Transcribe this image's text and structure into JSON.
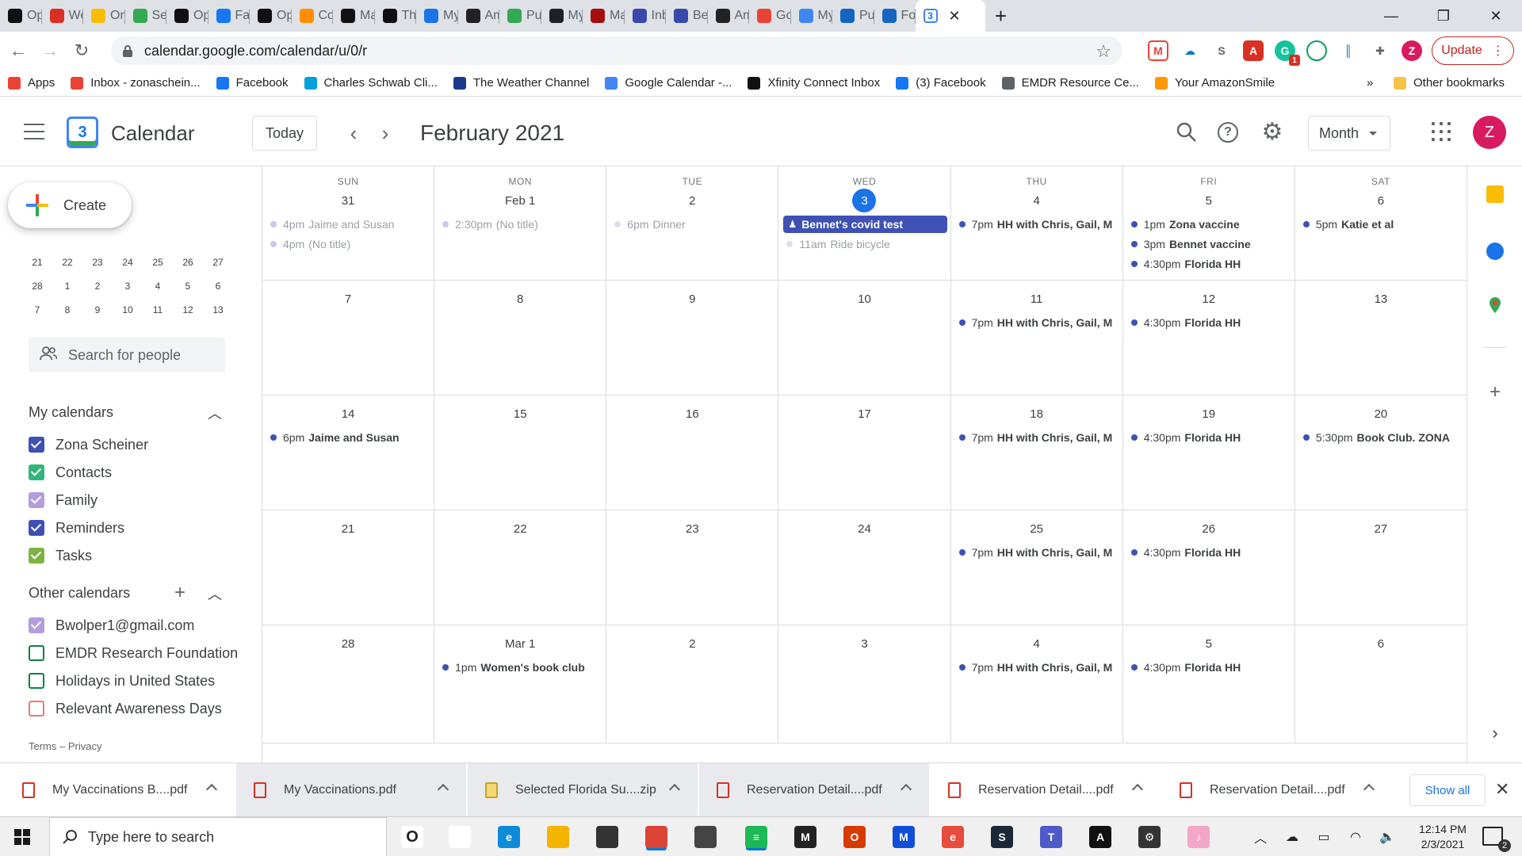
{
  "browser": {
    "tabs": [
      {
        "label": "Op",
        "icon": "nyt-icon",
        "color": "#111111"
      },
      {
        "label": "We",
        "icon": "red-icon",
        "color": "#d93025"
      },
      {
        "label": "On",
        "icon": "pinwheel-icon",
        "color": "#fbbc05"
      },
      {
        "label": "Sel",
        "icon": "pinwheel-icon",
        "color": "#34a853"
      },
      {
        "label": "Op",
        "icon": "nyt-icon",
        "color": "#111111"
      },
      {
        "label": "Fac",
        "icon": "facebook-icon",
        "color": "#1877f2"
      },
      {
        "label": "Op",
        "icon": "nyt-icon",
        "color": "#111111"
      },
      {
        "label": "Co",
        "icon": "carrot-icon",
        "color": "#ff8f00"
      },
      {
        "label": "Ma",
        "icon": "x-icon",
        "color": "#111111"
      },
      {
        "label": "The",
        "icon": "wp-icon",
        "color": "#111111"
      },
      {
        "label": "My",
        "icon": "cloud-icon",
        "color": "#1a73e8"
      },
      {
        "label": "Am",
        "icon": "amazon-icon",
        "color": "#222222"
      },
      {
        "label": "Pul",
        "icon": "pub-icon",
        "color": "#34a853"
      },
      {
        "label": "My",
        "icon": "search-tab-icon",
        "color": "#202124"
      },
      {
        "label": "Ma",
        "icon": "sp-icon",
        "color": "#a50e0e"
      },
      {
        "label": "Inb",
        "icon": "v-icon",
        "color": "#3949ab"
      },
      {
        "label": "Be",
        "icon": "v-icon",
        "color": "#3949ab"
      },
      {
        "label": "Am",
        "icon": "amazon-icon",
        "color": "#222222"
      },
      {
        "label": "Go",
        "icon": "gmail-icon",
        "color": "#ea4335"
      },
      {
        "label": "My",
        "icon": "google-icon",
        "color": "#4285f4"
      },
      {
        "label": "Pul",
        "icon": "globe-icon",
        "color": "#1565c0"
      },
      {
        "label": "For",
        "icon": "globe-icon",
        "color": "#1565c0"
      }
    ],
    "active_tab_icon_text": "3",
    "url": "calendar.google.com/calendar/u/0/r",
    "update_label": "Update",
    "ext_badge": "1",
    "bookmarks": [
      {
        "label": "Apps",
        "color": "#ea4335",
        "icon": "apps-icon"
      },
      {
        "label": "Inbox - zonaschein...",
        "color": "#ea4335",
        "icon": "gmail-icon"
      },
      {
        "label": "Facebook",
        "color": "#1877f2",
        "icon": "facebook-icon"
      },
      {
        "label": "Charles Schwab Cli...",
        "color": "#00a0df",
        "icon": "schwab-icon"
      },
      {
        "label": "The Weather Channel",
        "color": "#1a3a8a",
        "icon": "weather-icon"
      },
      {
        "label": "Google Calendar -...",
        "color": "#4285f4",
        "icon": "calendar-icon"
      },
      {
        "label": "Xfinity Connect Inbox",
        "color": "#111111",
        "icon": "x-icon"
      },
      {
        "label": "(3) Facebook",
        "color": "#1877f2",
        "icon": "facebook-icon"
      },
      {
        "label": "EMDR Resource Ce...",
        "color": "#5f6368",
        "icon": "globe-icon"
      },
      {
        "label": "Your AmazonSmile",
        "color": "#ff9900",
        "icon": "amazon-icon"
      }
    ],
    "bookmarks_overflow": "»",
    "other_bookmarks": "Other bookmarks"
  },
  "app": {
    "title": "Calendar",
    "logo_text": "3",
    "today_label": "Today",
    "month_title": "February 2021",
    "view_label": "Month",
    "avatar_initial": "Z"
  },
  "sidebar": {
    "create_label": "Create",
    "minical_rows": [
      [
        "21",
        "22",
        "23",
        "24",
        "25",
        "26",
        "27"
      ],
      [
        "28",
        "1",
        "2",
        "3",
        "4",
        "5",
        "6"
      ],
      [
        "7",
        "8",
        "9",
        "10",
        "11",
        "12",
        "13"
      ]
    ],
    "people_search_placeholder": "Search for people",
    "my_calendars_title": "My calendars",
    "my_calendars": [
      {
        "label": "Zona Scheiner",
        "color": "#3f51b5",
        "checked": true
      },
      {
        "label": "Contacts",
        "color": "#33b679",
        "checked": true
      },
      {
        "label": "Family",
        "color": "#b39ddb",
        "checked": true
      },
      {
        "label": "Reminders",
        "color": "#3f51b5",
        "checked": true
      },
      {
        "label": "Tasks",
        "color": "#7cb342",
        "checked": true
      }
    ],
    "other_calendars_title": "Other calendars",
    "other_calendars": [
      {
        "label": "Bwolper1@gmail.com",
        "color": "#b39ddb",
        "checked": true
      },
      {
        "label": "EMDR Research Foundation",
        "color": "#0b8043",
        "checked": false
      },
      {
        "label": "Holidays in United States",
        "color": "#0b8043",
        "checked": false
      },
      {
        "label": "Relevant Awareness Days",
        "color": "#e67c73",
        "checked": false
      }
    ],
    "footer": "Terms – Privacy"
  },
  "colors": {
    "accent": "#1a73e8",
    "primary_event": "#3f51b5",
    "family_event": "#b39ddb",
    "faded_event": "#c5cae9"
  },
  "grid": {
    "weekdays": [
      "SUN",
      "MON",
      "TUE",
      "WED",
      "THU",
      "FRI",
      "SAT"
    ],
    "weeks": [
      [
        {
          "day": "31",
          "events": [
            {
              "time": "4pm",
              "name": "Jaime and Susan",
              "color": "#c5cae9",
              "past": true
            },
            {
              "time": "4pm",
              "name": "(No title)",
              "color": "#c5cae9",
              "past": true
            }
          ]
        },
        {
          "day": "Feb 1",
          "events": [
            {
              "time": "2:30pm",
              "name": "(No title)",
              "color": "#c5cae9",
              "past": true
            }
          ]
        },
        {
          "day": "2",
          "events": [
            {
              "time": "6pm",
              "name": "Dinner",
              "color": "#e1dcf0",
              "past": true
            }
          ]
        },
        {
          "day": "3",
          "today": true,
          "events": [
            {
              "time": "",
              "name": "Bennet's covid test",
              "block": true
            },
            {
              "time": "11am",
              "name": "Ride bicycle",
              "color": "#e1dcf0",
              "past": true
            }
          ]
        },
        {
          "day": "4",
          "events": [
            {
              "time": "7pm",
              "name": "HH with Chris, Gail, M",
              "color": "#3f51b5"
            }
          ]
        },
        {
          "day": "5",
          "events": [
            {
              "time": "1pm",
              "name": "Zona vaccine",
              "color": "#3f51b5"
            },
            {
              "time": "3pm",
              "name": "Bennet vaccine",
              "color": "#3f51b5"
            },
            {
              "time": "4:30pm",
              "name": "Florida HH",
              "color": "#3f51b5"
            }
          ]
        },
        {
          "day": "6",
          "events": [
            {
              "time": "5pm",
              "name": "Katie et al",
              "color": "#3f51b5"
            }
          ]
        }
      ],
      [
        {
          "day": "7",
          "events": []
        },
        {
          "day": "8",
          "events": []
        },
        {
          "day": "9",
          "events": []
        },
        {
          "day": "10",
          "events": []
        },
        {
          "day": "11",
          "events": [
            {
              "time": "7pm",
              "name": "HH with Chris, Gail, M",
              "color": "#3f51b5"
            }
          ]
        },
        {
          "day": "12",
          "events": [
            {
              "time": "4:30pm",
              "name": "Florida HH",
              "color": "#3f51b5"
            }
          ]
        },
        {
          "day": "13",
          "events": []
        }
      ],
      [
        {
          "day": "14",
          "events": [
            {
              "time": "6pm",
              "name": "Jaime and Susan",
              "color": "#3f51b5"
            }
          ]
        },
        {
          "day": "15",
          "events": []
        },
        {
          "day": "16",
          "events": []
        },
        {
          "day": "17",
          "events": []
        },
        {
          "day": "18",
          "events": [
            {
              "time": "7pm",
              "name": "HH with Chris, Gail, M",
              "color": "#3f51b5"
            }
          ]
        },
        {
          "day": "19",
          "events": [
            {
              "time": "4:30pm",
              "name": "Florida HH",
              "color": "#3f51b5"
            }
          ]
        },
        {
          "day": "20",
          "events": [
            {
              "time": "5:30pm",
              "name": "Book Club. ZONA",
              "color": "#3f51b5"
            }
          ]
        }
      ],
      [
        {
          "day": "21",
          "events": []
        },
        {
          "day": "22",
          "events": []
        },
        {
          "day": "23",
          "events": []
        },
        {
          "day": "24",
          "events": []
        },
        {
          "day": "25",
          "events": [
            {
              "time": "7pm",
              "name": "HH with Chris, Gail, M",
              "color": "#3f51b5"
            }
          ]
        },
        {
          "day": "26",
          "events": [
            {
              "time": "4:30pm",
              "name": "Florida HH",
              "color": "#3f51b5"
            }
          ]
        },
        {
          "day": "27",
          "events": []
        }
      ],
      [
        {
          "day": "28",
          "events": []
        },
        {
          "day": "Mar 1",
          "events": [
            {
              "time": "1pm",
              "name": "Women's book club",
              "color": "#3f51b5"
            }
          ]
        },
        {
          "day": "2",
          "events": []
        },
        {
          "day": "3",
          "events": []
        },
        {
          "day": "4",
          "events": [
            {
              "time": "7pm",
              "name": "HH with Chris, Gail, M",
              "color": "#3f51b5"
            }
          ]
        },
        {
          "day": "5",
          "events": [
            {
              "time": "4:30pm",
              "name": "Florida HH",
              "color": "#3f51b5"
            }
          ]
        },
        {
          "day": "6",
          "events": []
        }
      ]
    ]
  },
  "downloads": {
    "items": [
      {
        "label": "My Vaccinations B....pdf",
        "type": "pdf",
        "highlighted": false
      },
      {
        "label": "My Vaccinations.pdf",
        "type": "pdf",
        "highlighted": true
      },
      {
        "label": "Selected Florida Su....zip",
        "type": "zip",
        "highlighted": true
      },
      {
        "label": "Reservation Detail....pdf",
        "type": "pdf",
        "highlighted": true
      },
      {
        "label": "Reservation Detail....pdf",
        "type": "pdf",
        "highlighted": false
      },
      {
        "label": "Reservation Detail....pdf",
        "type": "pdf",
        "highlighted": false
      }
    ],
    "show_all_label": "Show all"
  },
  "taskbar": {
    "search_placeholder": "Type here to search",
    "apps": [
      {
        "name": "cortana-icon",
        "color": "#ffffff",
        "text": "O"
      },
      {
        "name": "task-view-icon",
        "color": "#ffffff",
        "text": ""
      },
      {
        "name": "edge-icon",
        "color": "#0c8bd8",
        "text": "e"
      },
      {
        "name": "file-explorer-icon",
        "color": "#f4b400",
        "text": ""
      },
      {
        "name": "store-icon",
        "color": "#333333",
        "text": ""
      },
      {
        "name": "chrome-icon",
        "color": "#db4437",
        "text": "",
        "active": true
      },
      {
        "name": "paper-plane-icon",
        "color": "#444444",
        "text": ""
      },
      {
        "name": "spotify-icon",
        "color": "#1db954",
        "text": "≡",
        "active": true
      },
      {
        "name": "app-icon",
        "color": "#222222",
        "text": "M"
      },
      {
        "name": "office-icon",
        "color": "#d83b01",
        "text": "O"
      },
      {
        "name": "malwarebytes-icon",
        "color": "#0f4fd8",
        "text": "M"
      },
      {
        "name": "internet-explorer-icon",
        "color": "#e74c3c",
        "text": "e"
      },
      {
        "name": "steam-icon",
        "color": "#1b2838",
        "text": "S"
      },
      {
        "name": "teams-icon",
        "color": "#5059c9",
        "text": "T"
      },
      {
        "name": "acrobat-icon",
        "color": "#111111",
        "text": "A"
      },
      {
        "name": "settings-icon",
        "color": "#333333",
        "text": "⚙"
      },
      {
        "name": "itunes-icon",
        "color": "#f4a6c8",
        "text": "♪"
      }
    ],
    "time": "12:14 PM",
    "date": "2/3/2021",
    "notification_count": "2"
  }
}
